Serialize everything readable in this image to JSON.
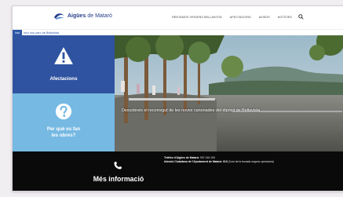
{
  "header": {
    "logo_main": "Aigües",
    "logo_sub": "de Mataró",
    "nav": [
      "RENTAMOS VIRGENS BELLAVISTA",
      "AFECTACIONS",
      "AVISOS",
      "NOTÍCIES"
    ]
  },
  "breadcrumb": {
    "home_label": "Inici",
    "text": "Inici nou parc de Bellavista"
  },
  "tiles": {
    "afectacions": "Afectacions",
    "why_line1": "Per què es fan",
    "why_line2": "les obres?"
  },
  "hero": {
    "caption": "Descobreix el recorregut de les noves canonades del dipòsit de Bellavista"
  },
  "footer": {
    "title": "Més informació",
    "phone_label": "Telèfon d'Aigües de Mataró:",
    "phone": "937 416 100",
    "oac_label": "Atenció Ciutadana de l'Ajuntament de Mataró:",
    "oac_value": "010",
    "oac_note": "(Cost de la trucada segons operadora)"
  },
  "colors": {
    "brand_blue": "#2f53a0",
    "light_blue": "#76b9e3",
    "footer_bg": "#0a0a0a"
  }
}
